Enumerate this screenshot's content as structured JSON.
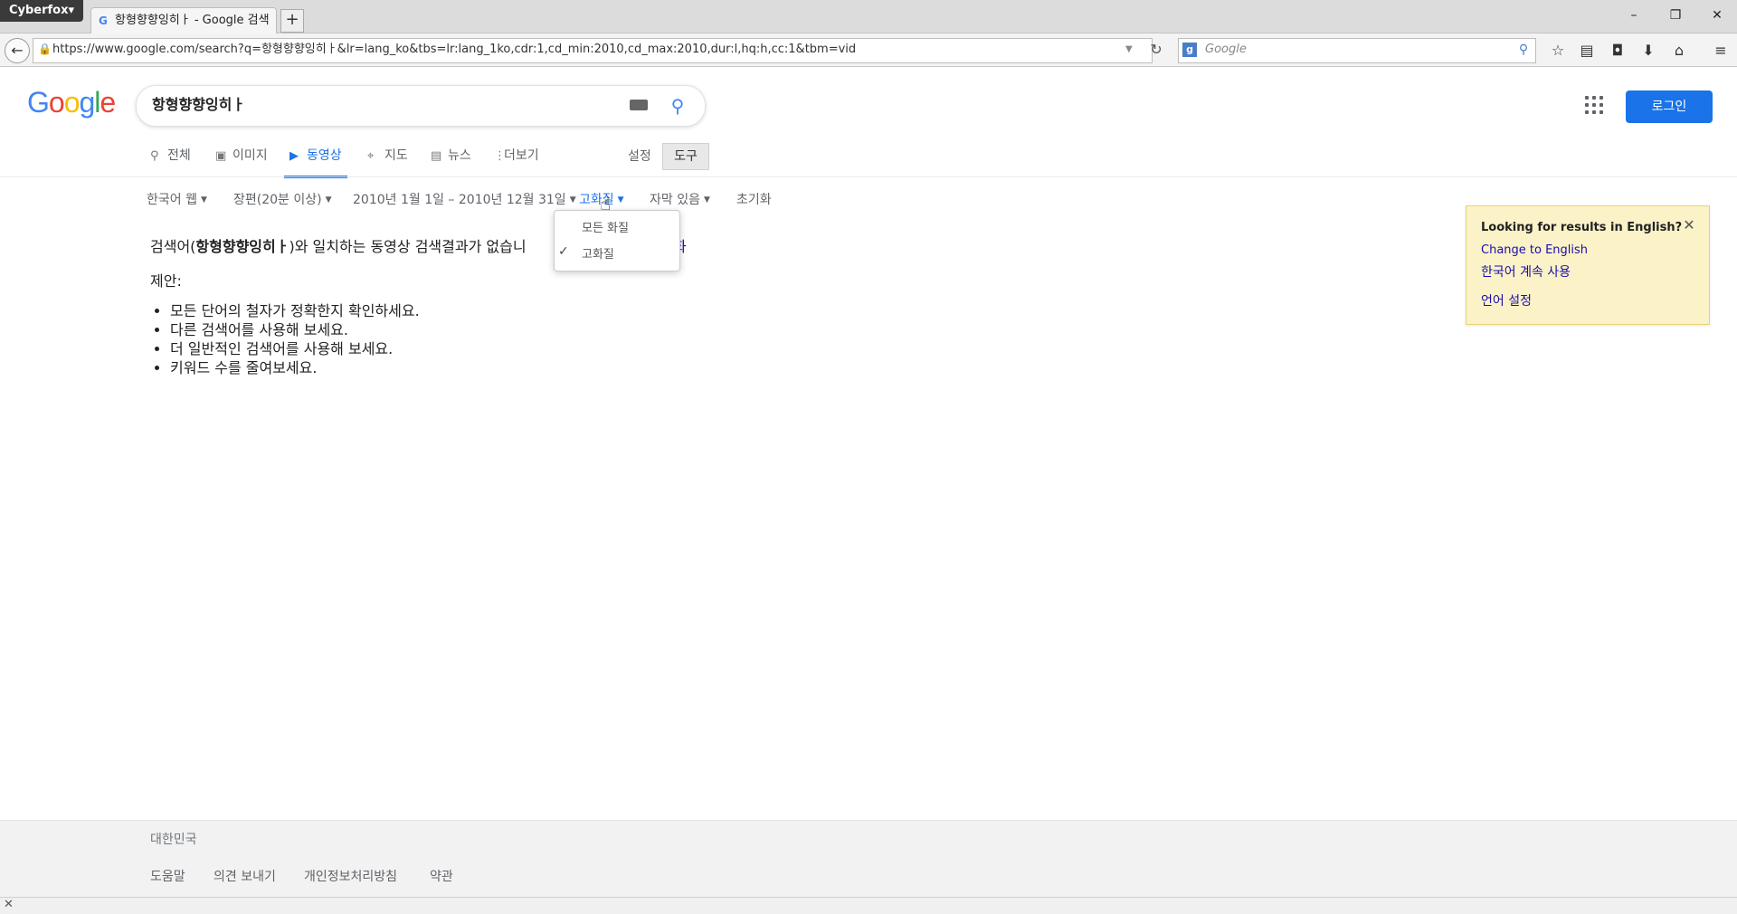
{
  "browser": {
    "app_menu": "Cyberfox",
    "tab_title": "항형향향잉히ㅏ - Google 검색",
    "new_tab": "+",
    "url": "https://www.google.com/search?q=항형향향잉히ㅏ&lr=lang_ko&tbs=lr:lang_1ko,cdr:1,cd_min:2010,cd_max:2010,dur:l,hq:h,cc:1&tbm=vid",
    "search_engine_placeholder": "Google",
    "window_controls": [
      "–",
      "❐",
      "✕"
    ],
    "toolbar_icons": [
      "star-icon",
      "reading-list-icon",
      "pocket-icon",
      "download-icon",
      "home-icon",
      "menu-icon"
    ]
  },
  "google": {
    "logo": [
      "G",
      "o",
      "o",
      "g",
      "l",
      "e"
    ],
    "query": "항형향향잉히ㅏ",
    "signin": "로그인",
    "tabs": [
      {
        "label": "전체",
        "icon": "search-icon"
      },
      {
        "label": "이미지",
        "icon": "image-icon"
      },
      {
        "label": "동영상",
        "icon": "video-icon",
        "active": true
      },
      {
        "label": "지도",
        "icon": "map-pin-icon"
      },
      {
        "label": "뉴스",
        "icon": "news-icon"
      },
      {
        "label": "더보기",
        "icon": "more-icon"
      }
    ],
    "settings": "설정",
    "tools": "도구",
    "filters": [
      "한국어 웹",
      "장편(20분 이상)",
      "2010년 1월 1일 – 2010년 12월 31일",
      "고화질",
      "자막 있음"
    ],
    "reset": "초기화",
    "quality_dropdown": [
      "모든 화질",
      "고화질"
    ],
    "quality_selected": "고화질"
  },
  "results": {
    "no_result_prefix": "검색어(",
    "no_result_query": "항형향향잉히ㅏ",
    "no_result_suffix": ")와 일치하는 동영상 검색결과가 없습니",
    "no_result_tail": "화",
    "suggestion_title": "제안:",
    "suggestions": [
      "모든 단어의 철자가 정확한지 확인하세요.",
      "다른 검색어를 사용해 보세요.",
      "더 일반적인 검색어를 사용해 보세요.",
      "키워드 수를 줄여보세요."
    ]
  },
  "language_box": {
    "question": "Looking for results in English?",
    "change_to_english": "Change to English",
    "keep_korean": "한국어 계속 사용",
    "language_settings": "언어 설정"
  },
  "footer": {
    "country": "대한민국",
    "links": [
      "도움말",
      "의견 보내기",
      "개인정보처리방침",
      "약관"
    ]
  },
  "colors": {
    "accent": "#1a73e8",
    "notice_bg": "#fbf2c8"
  }
}
